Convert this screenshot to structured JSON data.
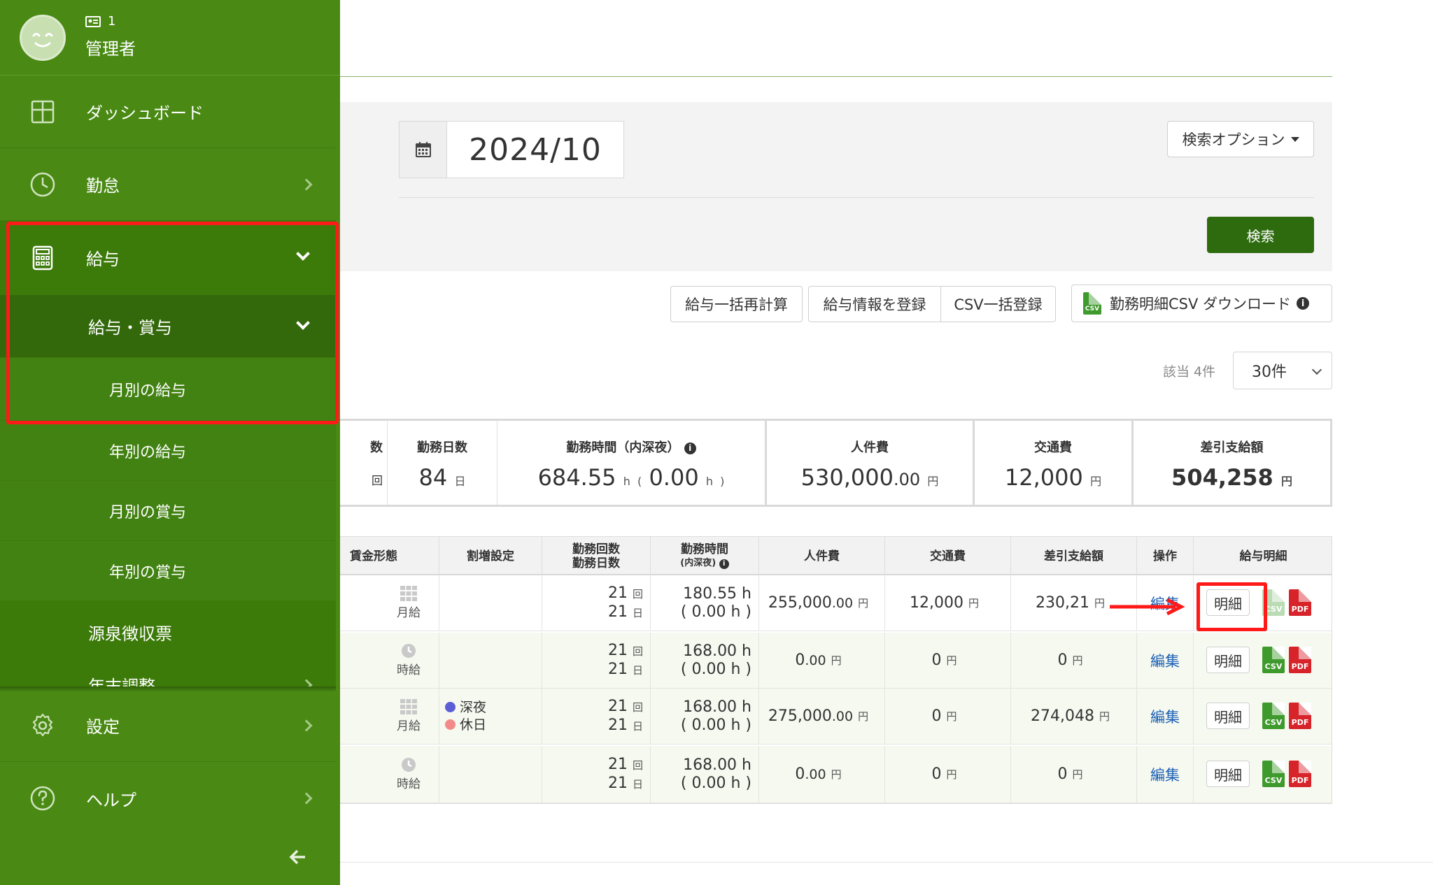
{
  "user": {
    "id": "1",
    "name": "管理者"
  },
  "sidebar": {
    "items": [
      {
        "label": "ダッシュボード",
        "icon": "dashboard-grid-icon"
      },
      {
        "label": "勤怠",
        "icon": "clock-icon"
      },
      {
        "label": "給与",
        "icon": "calculator-icon"
      },
      {
        "label": "給与・賞与"
      },
      {
        "label": "月別の給与"
      },
      {
        "label": "年別の給与"
      },
      {
        "label": "月別の賞与"
      },
      {
        "label": "年別の賞与"
      },
      {
        "label": "源泉徴収票"
      },
      {
        "label": "年末調整"
      },
      {
        "label": "設定",
        "icon": "gear-icon"
      },
      {
        "label": "ヘルプ",
        "icon": "question-icon"
      }
    ],
    "collapse_icon": "arrow-left-icon"
  },
  "search": {
    "month_value": "2024/10",
    "options_label": "検索オプション",
    "submit_label": "検索"
  },
  "toolbar": {
    "recalc_label": "給与一括再計算",
    "register_label": "給与情報を登録",
    "csv_import_label": "CSV一括登録",
    "download_label": "勤務明細CSV ダウンロード"
  },
  "result": {
    "count_label": "該当 4件",
    "per_page": "30件"
  },
  "summary": {
    "partial_head": "数",
    "partial_unit": "回",
    "days_head": "勤務日数",
    "days_value": "84",
    "days_unit": "日",
    "hours_head": "勤務時間（内深夜）",
    "hours_value": "684.55",
    "hours_unit": "h",
    "hours_paren_open": "(",
    "night_value": "0.00",
    "night_unit": "h",
    "hours_paren_close": ")",
    "cost_head": "人件費",
    "cost_value": "530,000",
    "cost_decimal": ".00",
    "cost_unit": "円",
    "transport_head": "交通費",
    "transport_value": "12,000",
    "transport_unit": "円",
    "net_head": "差引支給額",
    "net_value": "504,258",
    "net_unit": "円"
  },
  "table": {
    "headers": {
      "wage_type": "賃金形態",
      "premium": "割増設定",
      "work_count": "勤務回数",
      "work_days": "勤務日数",
      "work_hours": "勤務時間",
      "night_sub": "(内深夜)",
      "cost": "人件費",
      "transport": "交通費",
      "net": "差引支給額",
      "action": "操作",
      "payslip": "給与明細"
    },
    "rows": [
      {
        "wage_type": "月給",
        "wage_icon": "grid-calendar-icon",
        "premium_tags": [],
        "count": "21",
        "count_unit": "回",
        "days": "21",
        "days_unit": "日",
        "hours": "180.55 h",
        "night": "( 0.00 h )",
        "cost": "255,000",
        "cost_dec": ".00",
        "cost_unit": "円",
        "transport": "12,000",
        "transport_unit": "円",
        "net": "230,21",
        "net_unit": "円",
        "edit": "編集",
        "detail": "明細"
      },
      {
        "wage_type": "時給",
        "wage_icon": "clock-icon",
        "premium_tags": [],
        "count": "21",
        "count_unit": "回",
        "days": "21",
        "days_unit": "日",
        "hours": "168.00 h",
        "night": "( 0.00 h )",
        "cost": "0",
        "cost_dec": ".00",
        "cost_unit": "円",
        "transport": "0",
        "transport_unit": "円",
        "net": "0",
        "net_unit": "円",
        "edit": "編集",
        "detail": "明細"
      },
      {
        "wage_type": "月給",
        "wage_icon": "grid-calendar-icon",
        "premium_tags": [
          {
            "label": "深夜",
            "color": "#5b5fd6"
          },
          {
            "label": "休日",
            "color": "#f28a8a"
          }
        ],
        "count": "21",
        "count_unit": "回",
        "days": "21",
        "days_unit": "日",
        "hours": "168.00 h",
        "night": "( 0.00 h )",
        "cost": "275,000",
        "cost_dec": ".00",
        "cost_unit": "円",
        "transport": "0",
        "transport_unit": "円",
        "net": "274,048",
        "net_unit": "円",
        "edit": "編集",
        "detail": "明細"
      },
      {
        "wage_type": "時給",
        "wage_icon": "clock-icon",
        "premium_tags": [],
        "count": "21",
        "count_unit": "回",
        "days": "21",
        "days_unit": "日",
        "hours": "168.00 h",
        "night": "( 0.00 h )",
        "cost": "0",
        "cost_dec": ".00",
        "cost_unit": "円",
        "transport": "0",
        "transport_unit": "円",
        "net": "0",
        "net_unit": "円",
        "edit": "編集",
        "detail": "明細"
      }
    ],
    "csv_label": "CSV",
    "pdf_label": "PDF"
  },
  "colors": {
    "sidebar": "#4a8a14",
    "primary": "#2e6b0f",
    "highlight": "#ff1a1a",
    "link": "#1a5fb4"
  }
}
